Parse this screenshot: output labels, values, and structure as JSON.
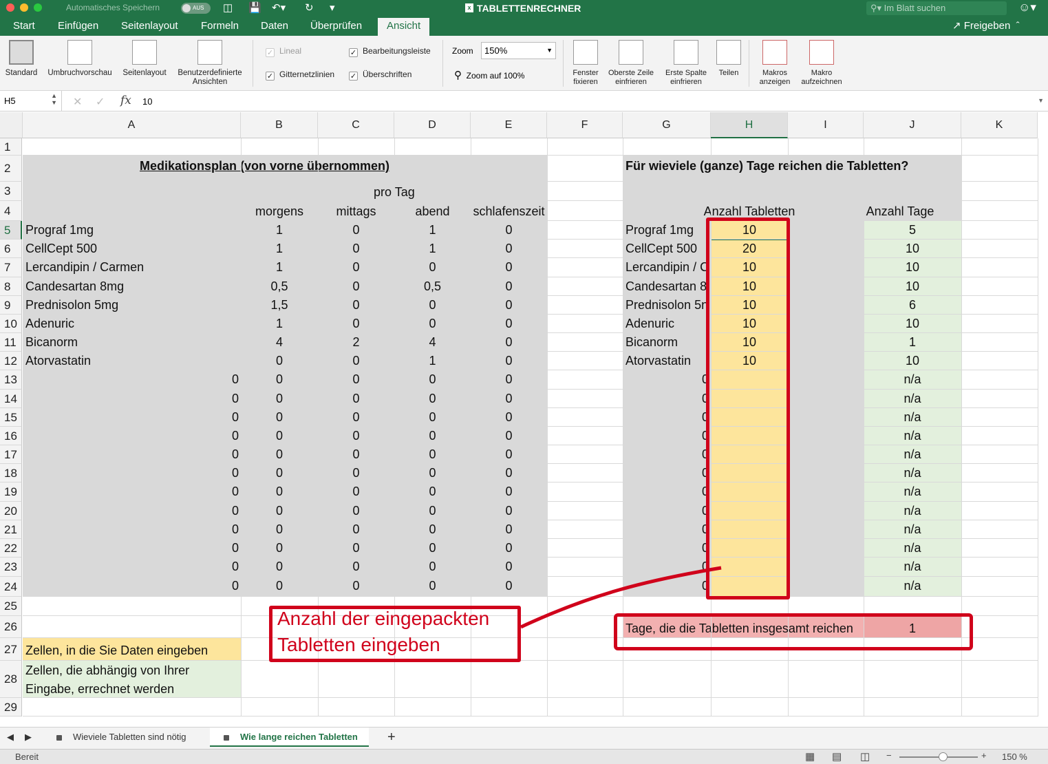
{
  "window": {
    "title": "TABLETTENRECHNER",
    "autosave_label": "Automatisches Speichern",
    "autosave_state": "AUS",
    "search_placeholder": "Im Blatt suchen"
  },
  "ribbon_tabs": [
    "Start",
    "Einfügen",
    "Seitenlayout",
    "Formeln",
    "Daten",
    "Überprüfen",
    "Ansicht"
  ],
  "active_tab": "Ansicht",
  "share_label": "Freigeben",
  "ribbon": {
    "views": [
      "Standard",
      "Umbruchvorschau",
      "Seitenlayout",
      "Benutzerdefinierte Ansichten"
    ],
    "show": {
      "lineal": "Lineal",
      "bearbeitungsleiste": "Bearbeitungsleiste",
      "gitternetzlinien": "Gitternetzlinien",
      "ueberschriften": "Überschriften"
    },
    "zoom_label": "Zoom",
    "zoom_value": "150%",
    "zoom_100": "Zoom auf 100%",
    "freeze": [
      "Fenster fixieren",
      "Oberste Zeile einfrieren",
      "Erste Spalte einfrieren",
      "Teilen"
    ],
    "macros": [
      "Makros anzeigen",
      "Makro aufzeichnen"
    ]
  },
  "formula_bar": {
    "name_box": "H5",
    "fx": "fx",
    "value": "10"
  },
  "columns": [
    "A",
    "B",
    "C",
    "D",
    "E",
    "F",
    "G",
    "H",
    "I",
    "J",
    "K"
  ],
  "selected_column": "H",
  "selected_row": "5",
  "sheet": {
    "left_title": "Medikationsplan (von vorne übernommen)",
    "pro_tag": "pro Tag",
    "headers": [
      "morgens",
      "mittags",
      "abend",
      "schlafenszeit"
    ],
    "meds": [
      {
        "name": "Prograf 1mg",
        "a": "",
        "b": "1",
        "c": "0",
        "d": "1",
        "e": "0"
      },
      {
        "name": "CellCept 500",
        "a": "",
        "b": "1",
        "c": "0",
        "d": "1",
        "e": "0"
      },
      {
        "name": "Lercandipin / Carmen",
        "a": "",
        "b": "1",
        "c": "0",
        "d": "0",
        "e": "0"
      },
      {
        "name": "Candesartan 8mg",
        "a": "",
        "b": "0,5",
        "c": "0",
        "d": "0,5",
        "e": "0"
      },
      {
        "name": "Prednisolon 5mg",
        "a": "",
        "b": "1,5",
        "c": "0",
        "d": "0",
        "e": "0"
      },
      {
        "name": "Adenuric",
        "a": "",
        "b": "1",
        "c": "0",
        "d": "0",
        "e": "0"
      },
      {
        "name": "Bicanorm",
        "a": "",
        "b": "4",
        "c": "2",
        "d": "4",
        "e": "0"
      },
      {
        "name": "Atorvastatin",
        "a": "",
        "b": "0",
        "c": "0",
        "d": "1",
        "e": "0"
      },
      {
        "name": "",
        "a": "0",
        "b": "0",
        "c": "0",
        "d": "0",
        "e": "0"
      },
      {
        "name": "",
        "a": "0",
        "b": "0",
        "c": "0",
        "d": "0",
        "e": "0"
      },
      {
        "name": "",
        "a": "0",
        "b": "0",
        "c": "0",
        "d": "0",
        "e": "0"
      },
      {
        "name": "",
        "a": "0",
        "b": "0",
        "c": "0",
        "d": "0",
        "e": "0"
      },
      {
        "name": "",
        "a": "0",
        "b": "0",
        "c": "0",
        "d": "0",
        "e": "0"
      },
      {
        "name": "",
        "a": "0",
        "b": "0",
        "c": "0",
        "d": "0",
        "e": "0"
      },
      {
        "name": "",
        "a": "0",
        "b": "0",
        "c": "0",
        "d": "0",
        "e": "0"
      },
      {
        "name": "",
        "a": "0",
        "b": "0",
        "c": "0",
        "d": "0",
        "e": "0"
      },
      {
        "name": "",
        "a": "0",
        "b": "0",
        "c": "0",
        "d": "0",
        "e": "0"
      },
      {
        "name": "",
        "a": "0",
        "b": "0",
        "c": "0",
        "d": "0",
        "e": "0"
      },
      {
        "name": "",
        "a": "0",
        "b": "0",
        "c": "0",
        "d": "0",
        "e": "0"
      },
      {
        "name": "",
        "a": "0",
        "b": "0",
        "c": "0",
        "d": "0",
        "e": "0"
      }
    ],
    "right_title": "Für wieviele (ganze) Tage reichen die Tabletten?",
    "col_h_header": "Anzahl Tabletten",
    "col_j_header": "Anzahl Tage",
    "right_rows": [
      {
        "g": "Prograf 1mg",
        "h": "10",
        "j": "5"
      },
      {
        "g": "CellCept 500",
        "h": "20",
        "j": "10"
      },
      {
        "g": "Lercandipin / C",
        "h": "10",
        "j": "10"
      },
      {
        "g": "Candesartan 8",
        "h": "10",
        "j": "10"
      },
      {
        "g": "Prednisolon 5n",
        "h": "10",
        "j": "6"
      },
      {
        "g": "Adenuric",
        "h": "10",
        "j": "10"
      },
      {
        "g": "Bicanorm",
        "h": "10",
        "j": "1"
      },
      {
        "g": "Atorvastatin",
        "h": "10",
        "j": "10"
      },
      {
        "g": "0",
        "h": "",
        "j": "n/a"
      },
      {
        "g": "0",
        "h": "",
        "j": "n/a"
      },
      {
        "g": "0",
        "h": "",
        "j": "n/a"
      },
      {
        "g": "0",
        "h": "",
        "j": "n/a"
      },
      {
        "g": "0",
        "h": "",
        "j": "n/a"
      },
      {
        "g": "0",
        "h": "",
        "j": "n/a"
      },
      {
        "g": "0",
        "h": "",
        "j": "n/a"
      },
      {
        "g": "0",
        "h": "",
        "j": "n/a"
      },
      {
        "g": "0",
        "h": "",
        "j": "n/a"
      },
      {
        "g": "0",
        "h": "",
        "j": "n/a"
      },
      {
        "g": "0",
        "h": "",
        "j": "n/a"
      },
      {
        "g": "0",
        "h": "",
        "j": "n/a"
      }
    ],
    "total_label": "Tage, die die Tabletten insgesamt reichen",
    "total_value": "1",
    "legend_input": "Zellen, in die Sie Daten eingeben",
    "legend_calc_1": "Zellen, die abhängig von Ihrer",
    "legend_calc_2": "Eingabe, errechnet werden",
    "annotation_1": "Anzahl der eingepackten",
    "annotation_2": "Tabletten eingeben"
  },
  "sheet_tabs": [
    "Wieviele Tabletten sind nötig",
    "Wie lange reichen Tabletten"
  ],
  "active_sheet": "Wie lange reichen Tabletten",
  "status": {
    "text": "Bereit",
    "zoom": "150 %"
  },
  "colors": {
    "accent": "#227447",
    "gray_fill": "#d9d9d9",
    "input_fill": "#fde59c",
    "calc_fill": "#e3f0dd",
    "annotation": "#d0021b",
    "total_fill": "#f0a3a3"
  }
}
